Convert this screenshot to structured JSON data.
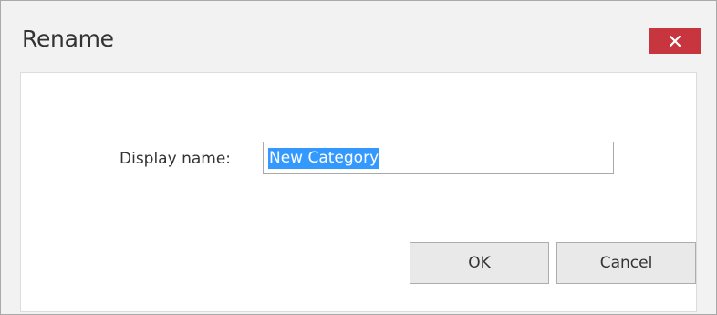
{
  "dialog": {
    "title": "Rename",
    "close_icon": "close-icon",
    "close_color": "#c7363e"
  },
  "form": {
    "label": "Display name:",
    "value": "New Category",
    "selection_color": "#3399ff"
  },
  "buttons": {
    "ok_label": "OK",
    "cancel_label": "Cancel"
  }
}
